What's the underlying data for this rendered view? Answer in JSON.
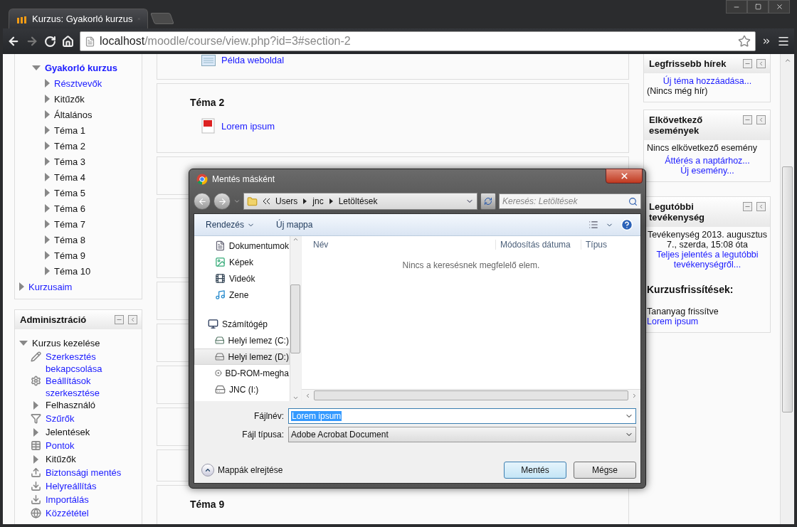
{
  "browser": {
    "tabs": [
      {
        "title": "Kurzus: Gyakorló kurzus",
        "selected": true
      }
    ],
    "url": {
      "host": "localhost",
      "path": "/moodle/course/view.php?id=3#section-2"
    }
  },
  "navigation": {
    "course": {
      "label": "Gyakorló kurzus",
      "expanded": true
    },
    "items": [
      {
        "label": "Résztvevők",
        "link": true,
        "expanded": false
      },
      {
        "label": "Kitűzők",
        "link": false,
        "expanded": false
      },
      {
        "label": "Általános",
        "link": false,
        "expanded": false
      },
      {
        "label": "Téma 1",
        "link": false,
        "expanded": false
      },
      {
        "label": "Téma 2",
        "link": false,
        "expanded": false
      },
      {
        "label": "Téma 3",
        "link": false,
        "expanded": false
      },
      {
        "label": "Téma 4",
        "link": false,
        "expanded": false
      },
      {
        "label": "Téma 5",
        "link": false,
        "expanded": false
      },
      {
        "label": "Téma 6",
        "link": false,
        "expanded": false
      },
      {
        "label": "Téma 7",
        "link": false,
        "expanded": false
      },
      {
        "label": "Téma 8",
        "link": false,
        "expanded": false
      },
      {
        "label": "Téma 9",
        "link": false,
        "expanded": false
      },
      {
        "label": "Téma 10",
        "link": false,
        "expanded": false
      }
    ],
    "my_courses": {
      "label": "Kurzusaim",
      "expanded": false
    }
  },
  "admin": {
    "title": "Adminisztráció",
    "group": {
      "label": "Kurzus kezelése",
      "expanded": true
    },
    "items": [
      {
        "kind": "edit",
        "label": "Szerkesztés bekapcsolása",
        "link": true
      },
      {
        "kind": "settings",
        "label": "Beállítások szerkesztése",
        "link": true
      },
      {
        "kind": "branch",
        "label": "Felhasználó",
        "link": false
      },
      {
        "kind": "filter",
        "label": "Szűrők",
        "link": true
      },
      {
        "kind": "branch",
        "label": "Jelentések",
        "link": false
      },
      {
        "kind": "grades",
        "label": "Pontok",
        "link": true
      },
      {
        "kind": "branch",
        "label": "Kitűzők",
        "link": false
      },
      {
        "kind": "backup",
        "label": "Biztonsági mentés",
        "link": true
      },
      {
        "kind": "restore",
        "label": "Helyreállítás",
        "link": true
      },
      {
        "kind": "import",
        "label": "Importálás",
        "link": true
      },
      {
        "kind": "publish",
        "label": "Közzététel",
        "link": true
      }
    ]
  },
  "sections": [
    {
      "activities": [
        {
          "kind": "page",
          "label": "Példa weboldal"
        }
      ]
    },
    {
      "title": "Téma 2",
      "activities": [
        {
          "kind": "pdf",
          "label": "Lorem ipsum"
        }
      ]
    },
    {
      "title": "Téma 9"
    }
  ],
  "blocks": {
    "news": {
      "title": "Legfrissebb hírek",
      "link": "Új téma hozzáadása...",
      "text": "(Nincs még hír)"
    },
    "events": {
      "title": "Elkövetkező események",
      "text": "Nincs elkövetkező esemény",
      "links": [
        "Áttérés a naptárhoz...",
        "Új esemény..."
      ]
    },
    "recent": {
      "title": "Legutóbbi tevékenység",
      "since": "Tevékenység 2013. augusztus 7., szerda, 15:08 óta",
      "report_link": "Teljes jelentés a legutóbbi tevékenységről...",
      "heading": "Kurzusfrissítések:",
      "update": "Tananyag frissítve",
      "update_link": "Lorem ipsum"
    }
  },
  "dialog": {
    "title": "Mentés másként",
    "breadcrumb": [
      "Users",
      "jnc",
      "Letöltések"
    ],
    "search": {
      "placeholder": "Keresés: Letöltések"
    },
    "toolbar": {
      "organize": "Rendezés",
      "new_folder": "Új mappa"
    },
    "tree": [
      {
        "kind": "documents",
        "label": "Dokumentumok",
        "selected": false
      },
      {
        "kind": "pictures",
        "label": "Képek",
        "selected": false
      },
      {
        "kind": "videos",
        "label": "Videók",
        "selected": false
      },
      {
        "kind": "music",
        "label": "Zene",
        "selected": false
      },
      {
        "kind": "computer",
        "label": "Számítógép",
        "selected": false
      },
      {
        "kind": "system-drive",
        "label": "Helyi lemez (C:)",
        "selected": false
      },
      {
        "kind": "drive",
        "label": "Helyi lemez (D:)",
        "selected": true
      },
      {
        "kind": "disc",
        "label": "BD-ROM-megha",
        "selected": false
      },
      {
        "kind": "drive",
        "label": "JNC (I:)",
        "selected": false
      }
    ],
    "columns": [
      "Név",
      "Módosítás dátuma",
      "Típus"
    ],
    "empty_message": "Nincs a keresésnek megfelelő elem.",
    "filename": {
      "label": "Fájlnév:",
      "value": "Lorem ipsum",
      "value_selected": true
    },
    "filetype": {
      "label": "Fájl típusa:",
      "value": "Adobe Acrobat Document"
    },
    "hide_folders": "Mappák elrejtése",
    "buttons": [
      {
        "label": "Mentés",
        "default": true
      },
      {
        "label": "Mégse",
        "default": false
      }
    ]
  }
}
